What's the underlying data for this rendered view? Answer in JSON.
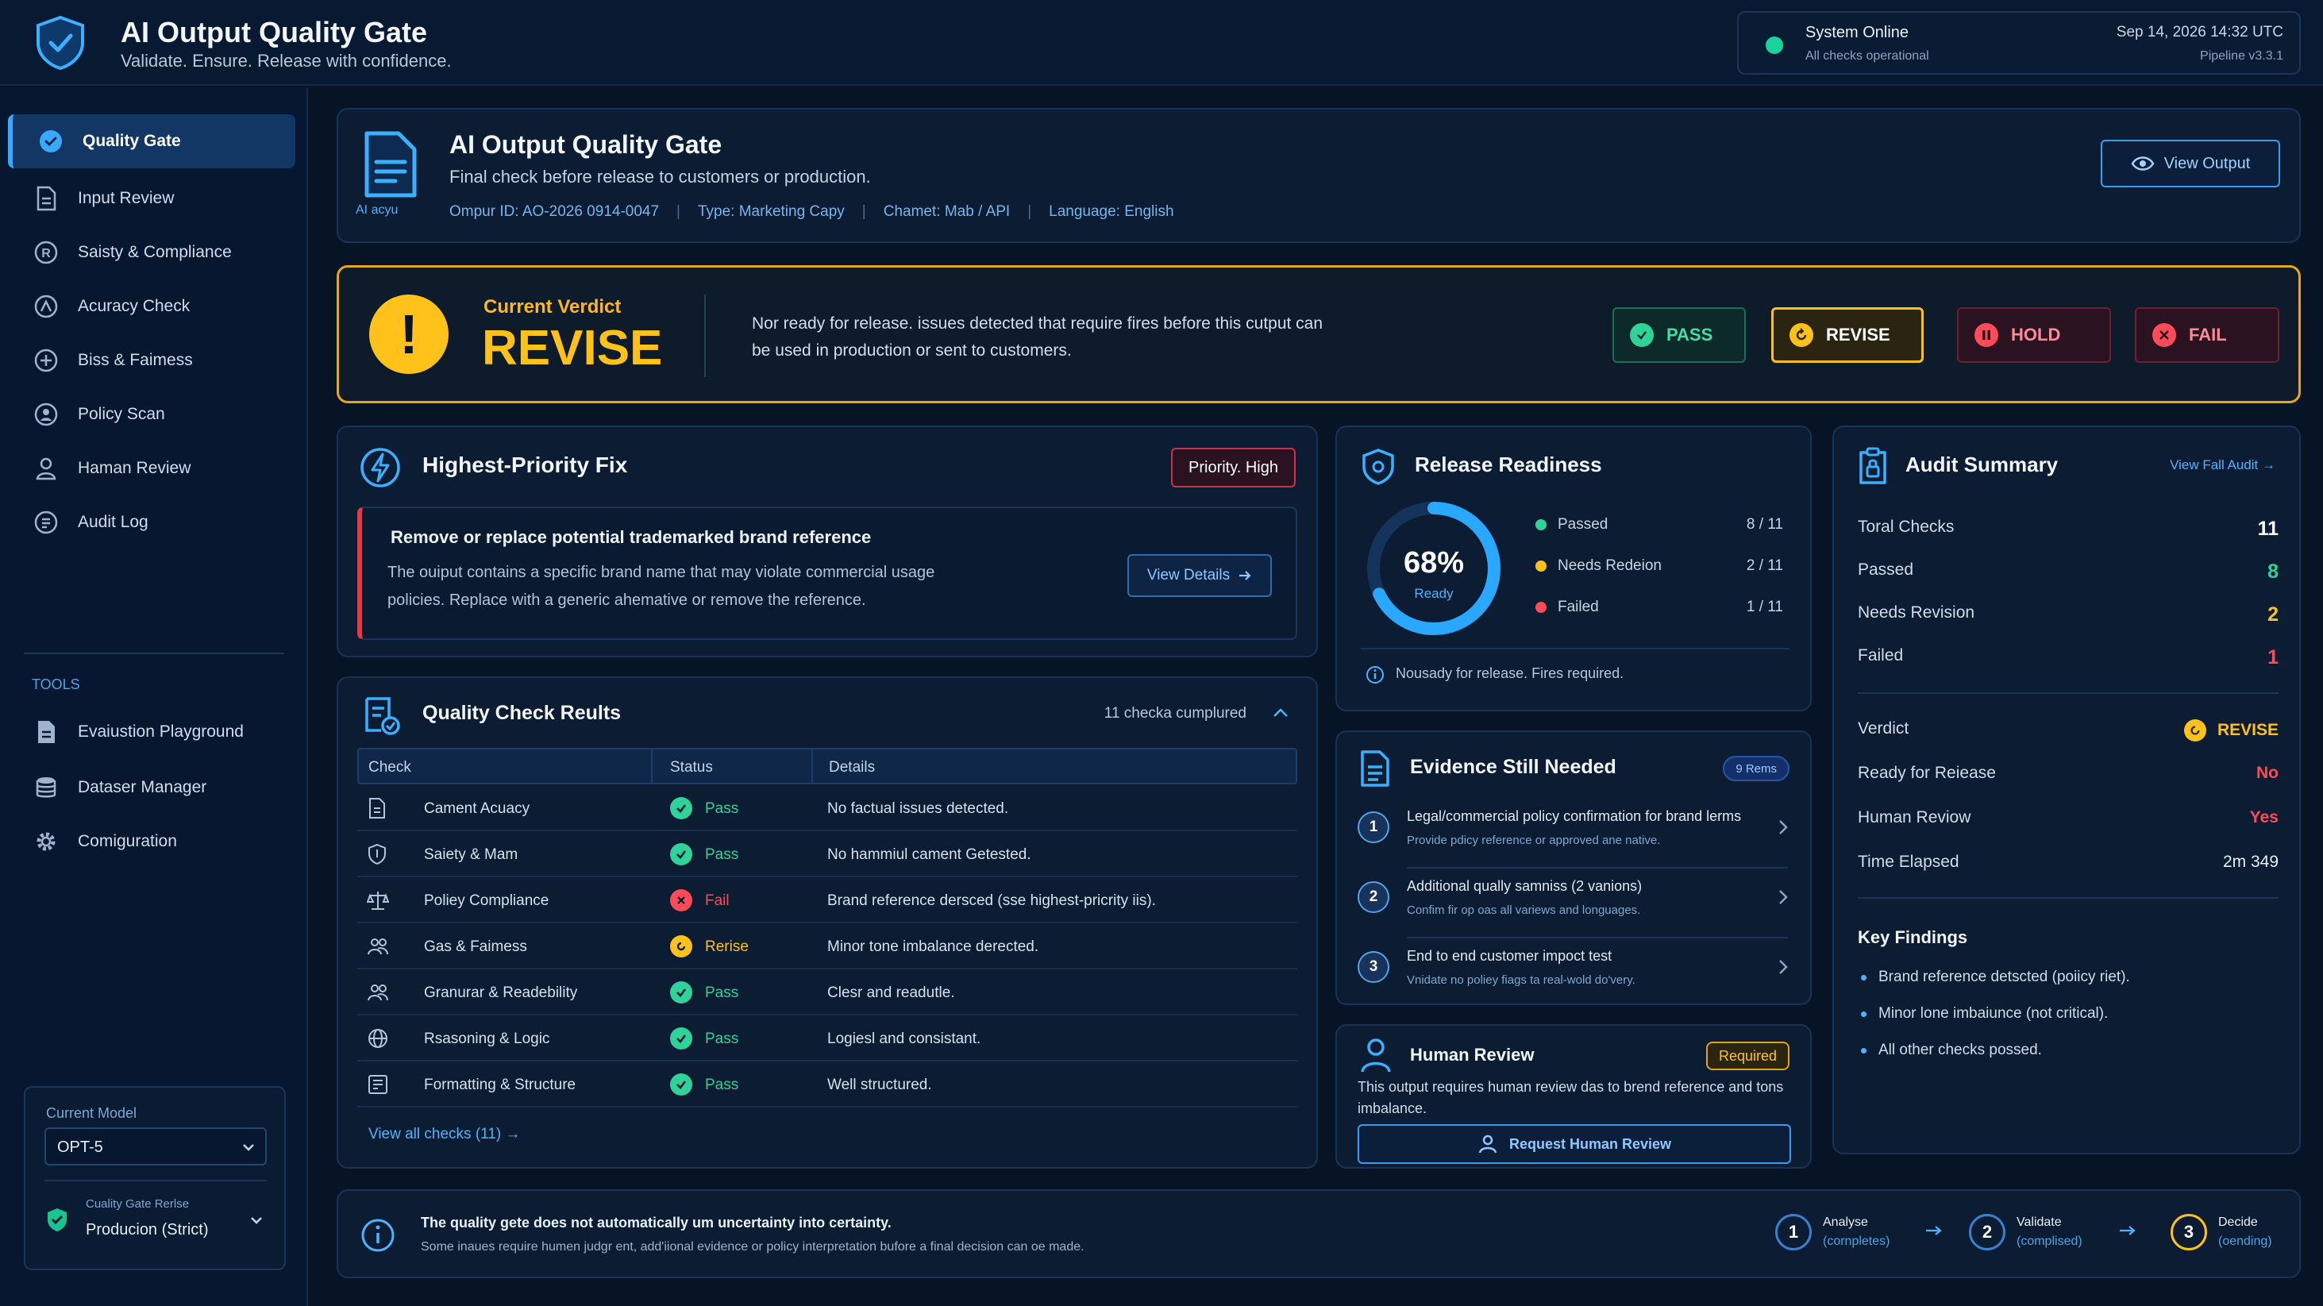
{
  "app": {
    "title": "AI Output Quality Gate",
    "subtitle": "Validate. Ensure. Release with confidence."
  },
  "system_status": {
    "title": "System Online",
    "subtitle": "All checks operational",
    "datetime": "Sep 14, 2026  14:32 UTC",
    "pipeline": "Pipeline v3.3.1",
    "color": "#19d49b"
  },
  "sidebar": {
    "items": [
      {
        "label": "Quality Gate",
        "icon": "shield-check-icon",
        "active": true
      },
      {
        "label": "Input Review",
        "icon": "document-icon"
      },
      {
        "label": "Saisty & Compliance",
        "icon": "registered-icon"
      },
      {
        "label": "Acuracy Check",
        "icon": "gauge-icon"
      },
      {
        "label": "Biss & Faimess",
        "icon": "plus-circle-icon"
      },
      {
        "label": "Policy Scan",
        "icon": "person-circle-icon"
      },
      {
        "label": "Haman Review",
        "icon": "person-icon"
      },
      {
        "label": "Audit Log",
        "icon": "audit-icon"
      }
    ],
    "tools_label": "TOOLS",
    "tools": [
      {
        "label": "Evaiustion Playground",
        "icon": "notebook-icon"
      },
      {
        "label": "Dataser Manager",
        "icon": "database-icon"
      },
      {
        "label": "Comiguration",
        "icon": "gear-icon"
      }
    ],
    "model": {
      "label": "Current Model",
      "value": "OPT-5",
      "mode_label": "Cuality Gate Rerlse",
      "mode_value": "Producion (Strict)"
    }
  },
  "output": {
    "title": "AI Output Quality Gate",
    "subtitle": "Final check before release to customers or production.",
    "doc_label": "AI acyu",
    "meta": [
      "Ompur ID:  AO-2026 0914-0047",
      "Type:  Marketing Capy",
      "Chamet: Mab / API",
      "Language:  English"
    ],
    "view_output": "View Output"
  },
  "verdict": {
    "label": "Current Verdict",
    "value": "REVISE",
    "icon": "!",
    "text": "Nor ready for release. issues detected that require fires before this cutput can be used in production or sent to customers.",
    "buttons": {
      "pass": "PASS",
      "revise": "REVISE",
      "hold": "HOLD",
      "fail": "FAIL"
    }
  },
  "priority_fix": {
    "title": "Highest-Priority Fix",
    "badge": "Priority. High",
    "card_title": "Remove or replace potential trademarked brand reference",
    "card_text": "The ouiput contains a specific brand name that may violate commercial usage policies. Replace with a generic ahemative or remove the reference.",
    "button": "View Details"
  },
  "checks": {
    "title": "Quality Check Reults",
    "count": "11 checka cumplured",
    "columns": [
      "Check",
      "Status",
      "Details"
    ],
    "rows": [
      {
        "name": "Cament Acuacy",
        "status": "Pass",
        "state": "pass",
        "detail": "No factual issues detected.",
        "icon": "document-icon"
      },
      {
        "name": "Saiety & Mam",
        "status": "Pass",
        "state": "pass",
        "detail": "No hammiul cament Getested.",
        "icon": "shield-icon"
      },
      {
        "name": "Poliey Compliance",
        "status": "Fail",
        "state": "fail",
        "detail": "Brand reference dersced (sse highest-pricrity iis).",
        "icon": "scales-icon"
      },
      {
        "name": "Gas & Faimess",
        "status": "Rerise",
        "state": "revise",
        "detail": "Minor tone imbalance derected.",
        "icon": "people-icon"
      },
      {
        "name": "Granurar & Readebility",
        "status": "Pass",
        "state": "pass",
        "detail": "Clesr and readutle.",
        "icon": "people-icon"
      },
      {
        "name": "Rsasoning & Logic",
        "status": "Pass",
        "state": "pass",
        "detail": "Logiesl and consistant.",
        "icon": "globe-icon"
      },
      {
        "name": "Formatting & Structure",
        "status": "Pass",
        "state": "pass",
        "detail": "Well structured.",
        "icon": "layout-icon"
      }
    ],
    "view_all": "View all checks (11)"
  },
  "readiness": {
    "title": "Release Readiness",
    "percent": 68,
    "percent_label": "68%",
    "ready_label": "Ready",
    "legend": [
      {
        "label": "Passed",
        "value": "8 / 11",
        "color": "#2fd39a"
      },
      {
        "label": "Needs Redeion",
        "value": "2 / 11",
        "color": "#ffc21a"
      },
      {
        "label": "Failed",
        "value": "1 / 11",
        "color": "#ff4a57"
      }
    ],
    "note": "Nousady for release. Fires required."
  },
  "evidence": {
    "title": "Evidence Still Needed",
    "badge": "9 Rems",
    "items": [
      {
        "n": "1",
        "title": "Legal/commercial policy confirmation for brand lerms",
        "sub": "Provide pdicy reference or approved ane native."
      },
      {
        "n": "2",
        "title": "Additional qually samniss (2 vanions)",
        "sub": "Confim fir op oas all variews and longuages."
      },
      {
        "n": "3",
        "title": "End to end customer impoct test",
        "sub": "Vnidate no poliey fiags ta real-wold do'very."
      }
    ]
  },
  "human_review": {
    "title": "Human Review",
    "badge": "Required",
    "text": "This output requires human review das to brend reference and tons imbalance.",
    "button": "Request Human Review"
  },
  "audit": {
    "title": "Audit Summary",
    "link": "View Fall Audit",
    "stats": [
      {
        "k": "Toral Checks",
        "v": "11",
        "color": "#ffffff"
      },
      {
        "k": "Passed",
        "v": "8",
        "color": "#2fd39a"
      },
      {
        "k": "Needs Revision",
        "v": "2",
        "color": "#ffc21a"
      },
      {
        "k": "Failed",
        "v": "1",
        "color": "#ff4a57"
      }
    ],
    "verdict_label": "Verdict",
    "verdict_value": "REVISE",
    "rows": [
      {
        "k": "Ready for Reiease",
        "v": "No",
        "color": "#ff4a57"
      },
      {
        "k": "Human Reviow",
        "v": "Yes",
        "color": "#ff4a57"
      },
      {
        "k": "Time Elapsed",
        "v": "2m 349",
        "color": "#e6edf6"
      }
    ],
    "findings_title": "Key Findings",
    "findings": [
      "Brand reference detscted (poiicy riet).",
      "Minor lone imbaiunce (not critical).",
      "All other checks possed."
    ]
  },
  "footer": {
    "title": "The quality gete does not automatically um uncertainty into certainty.",
    "subtitle": "Some inaues require humen judgr ent, add'iional evidence or policy interpretation bufore a final decision can oe made.",
    "steps": [
      {
        "n": "1",
        "label": "Analyse",
        "state": "(cornpletes)"
      },
      {
        "n": "2",
        "label": "Validate",
        "state": "(complised)"
      },
      {
        "n": "3",
        "label": "Decide",
        "state": "(oending)"
      }
    ]
  }
}
